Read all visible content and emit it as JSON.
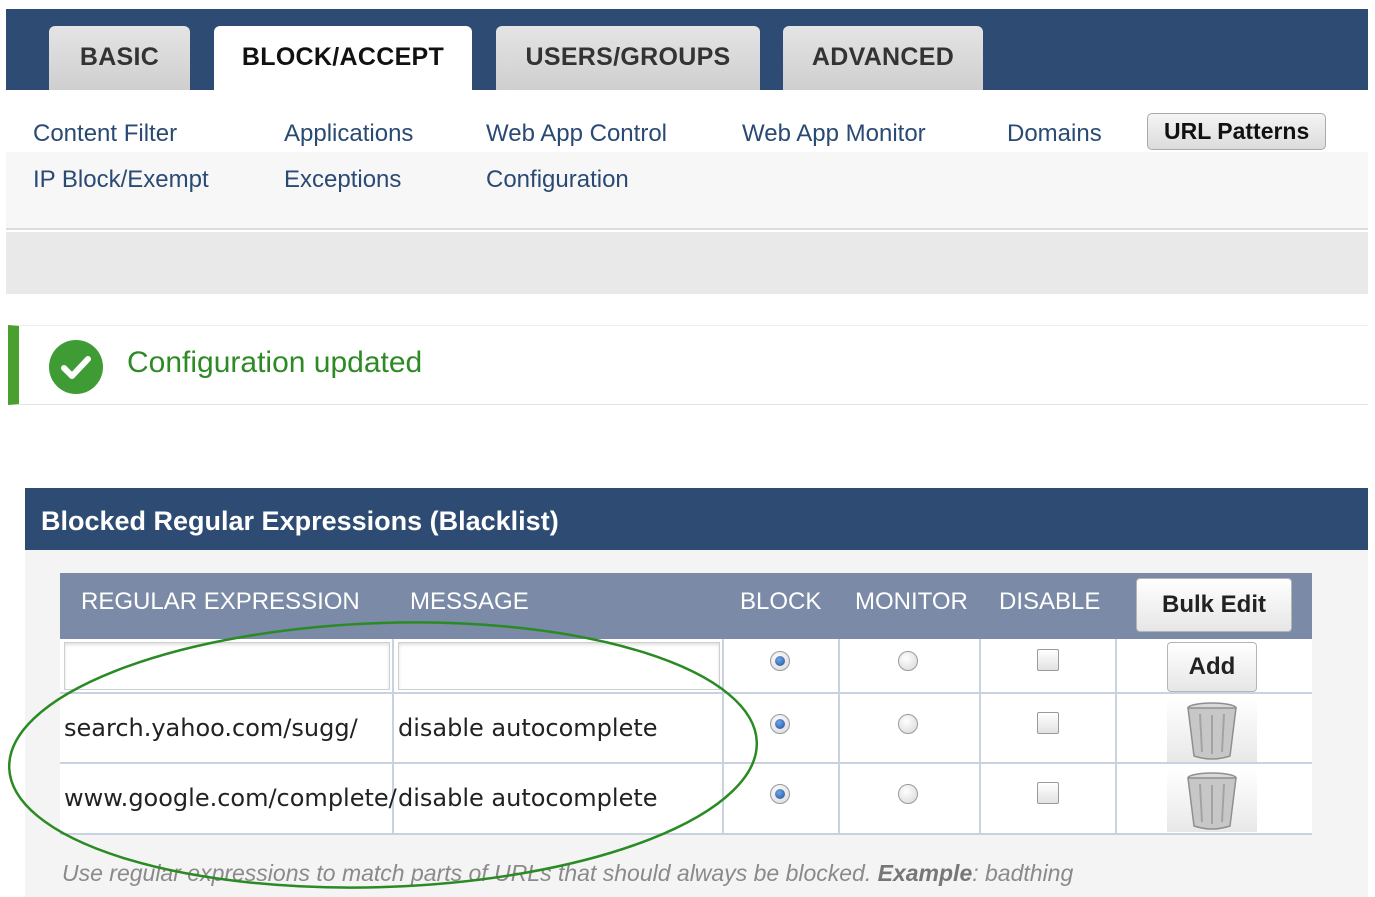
{
  "tabs": [
    {
      "label": "BASIC",
      "active": false
    },
    {
      "label": "BLOCK/ACCEPT",
      "active": true
    },
    {
      "label": "USERS/GROUPS",
      "active": false
    },
    {
      "label": "ADVANCED",
      "active": false
    }
  ],
  "subnav": {
    "items": [
      {
        "label": "Content Filter"
      },
      {
        "label": "Applications"
      },
      {
        "label": "Web App Control"
      },
      {
        "label": "Web App Monitor"
      },
      {
        "label": "Domains"
      },
      {
        "label": "URL Patterns",
        "active": true
      },
      {
        "label": "IP Block/Exempt"
      },
      {
        "label": "Exceptions"
      },
      {
        "label": "Configuration"
      }
    ]
  },
  "notice": {
    "text": "Configuration updated",
    "color": "#2e8a25",
    "icon": "check-circle-icon"
  },
  "panel": {
    "title": "Blocked Regular Expressions (Blacklist)"
  },
  "table": {
    "headers": {
      "regex": "REGULAR EXPRESSION",
      "message": "MESSAGE",
      "block": "BLOCK",
      "monitor": "MONITOR",
      "disable": "DISABLE"
    },
    "bulk_edit_label": "Bulk Edit",
    "new_row": {
      "regex_value": "",
      "message_value": "",
      "block": true,
      "monitor": false,
      "disable": false,
      "add_label": "Add"
    },
    "rows": [
      {
        "regex": "search.yahoo.com/sugg/",
        "message": "disable autocomplete",
        "block": true,
        "monitor": false,
        "disable": false,
        "action_icon": "trash-icon"
      },
      {
        "regex": "www.google.com/complete/",
        "message": "disable autocomplete",
        "block": true,
        "monitor": false,
        "disable": false,
        "action_icon": "trash-icon"
      }
    ]
  },
  "hint": {
    "text": "Use regular expressions to match parts of URLs that should always be blocked.",
    "example_label": "Example",
    "example_value": ": badthing"
  },
  "colors": {
    "nav_bg": "#2e4c73",
    "table_header_bg": "#7b8aa6",
    "success_green": "#49a02f",
    "annotation_ellipse": "#2a8a24"
  }
}
